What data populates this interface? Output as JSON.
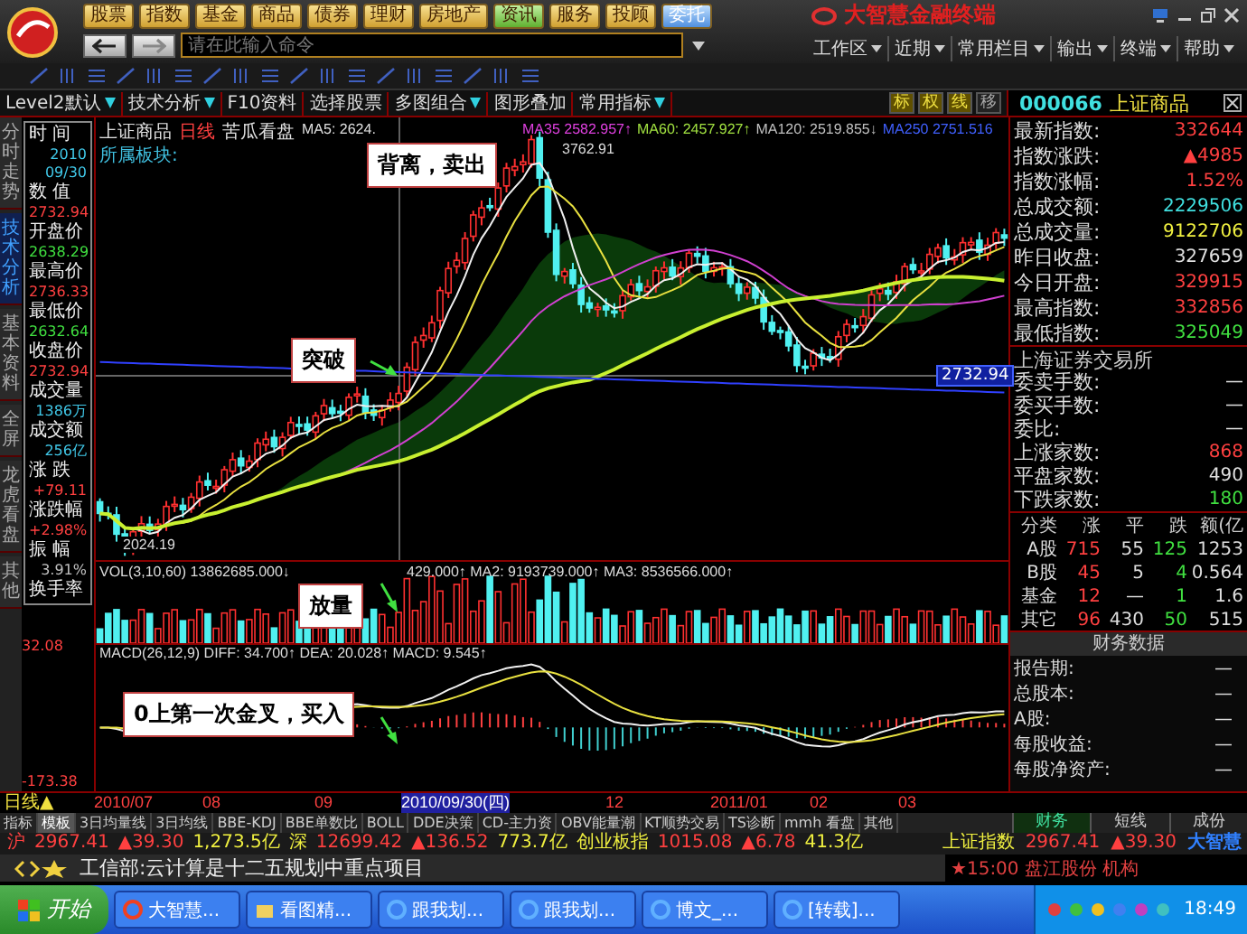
{
  "app": {
    "title": "大智慧金融终端",
    "logo_text": "大智慧"
  },
  "nav_buttons": [
    {
      "label": "股票",
      "kind": "normal"
    },
    {
      "label": "指数",
      "kind": "normal"
    },
    {
      "label": "基金",
      "kind": "normal"
    },
    {
      "label": "商品",
      "kind": "normal"
    },
    {
      "label": "债券",
      "kind": "normal"
    },
    {
      "label": "理财",
      "kind": "normal"
    },
    {
      "label": "房地产",
      "kind": "normal"
    },
    {
      "label": "资讯",
      "kind": "news"
    },
    {
      "label": "服务",
      "kind": "normal"
    },
    {
      "label": "投顾",
      "kind": "normal"
    },
    {
      "label": "委托",
      "kind": "trade"
    }
  ],
  "command_input": {
    "placeholder": "请在此输入命令"
  },
  "menu": [
    "工作区",
    "近期",
    "常用栏目",
    "输出",
    "终端",
    "帮助"
  ],
  "toolbar": [
    {
      "label": "Level2默认",
      "dropdown": true
    },
    {
      "label": "技术分析",
      "dropdown": true
    },
    {
      "label": "F10资料",
      "dropdown": false
    },
    {
      "label": "选择股票",
      "dropdown": false
    },
    {
      "label": "多图组合",
      "dropdown": true
    },
    {
      "label": "图形叠加",
      "dropdown": false
    },
    {
      "label": "常用指标",
      "dropdown": true
    }
  ],
  "toolbar_right": [
    {
      "label": "标",
      "on": true
    },
    {
      "label": "权",
      "on": true
    },
    {
      "label": "线",
      "on": true
    },
    {
      "label": "移",
      "on": false
    }
  ],
  "stock": {
    "code": "000066",
    "name": "上证商品"
  },
  "side_tabs": [
    {
      "label": "分时走势",
      "selected": false
    },
    {
      "label": "技术分析",
      "selected": true
    },
    {
      "label": "基本资料",
      "selected": false
    },
    {
      "label": "全屏",
      "selected": false
    },
    {
      "label": "龙虎看盘",
      "selected": false
    },
    {
      "label": "其他",
      "selected": false
    }
  ],
  "info_panel": [
    {
      "label": "时 间",
      "values": [
        "2010",
        "09/30"
      ],
      "color": "#40c8e8"
    },
    {
      "label": "数 值",
      "values": [
        "2732.94"
      ],
      "color": "#ff4040"
    },
    {
      "label": "开盘价",
      "values": [
        "2638.29"
      ],
      "color": "#40e040"
    },
    {
      "label": "最高价",
      "values": [
        "2736.33"
      ],
      "color": "#ff4040"
    },
    {
      "label": "最低价",
      "values": [
        "2632.64"
      ],
      "color": "#40e040"
    },
    {
      "label": "收盘价",
      "values": [
        "2732.94"
      ],
      "color": "#ff4040"
    },
    {
      "label": "成交量",
      "values": [
        "1386万"
      ],
      "color": "#40c8e8"
    },
    {
      "label": "成交额",
      "values": [
        "256亿"
      ],
      "color": "#40c8e8"
    },
    {
      "label": "涨 跌",
      "values": [
        "+79.11"
      ],
      "color": "#ff4040"
    },
    {
      "label": "涨跌幅",
      "values": [
        "+2.98%"
      ],
      "color": "#ff4040"
    },
    {
      "label": "振 幅",
      "values": [
        "3.91%"
      ],
      "color": "#c0c0c0"
    },
    {
      "label": "换手率"
    }
  ],
  "macd_axis": [
    "32.08",
    "-173.38"
  ],
  "chart": {
    "legend": [
      {
        "text": "上证商品",
        "color": "#e0e0e0"
      },
      {
        "text": "日线",
        "color": "#ff4040"
      },
      {
        "text": "苦瓜看盘",
        "color": "#e0e0e0"
      },
      {
        "text": "MA5: 2624.",
        "color": "#e0e0e0"
      }
    ],
    "legend_right": [
      {
        "text": "MA35 2582.957↑",
        "color": "#e040e0"
      },
      {
        "text": "MA60: 2457.927↑",
        "color": "#a0e040"
      },
      {
        "text": "MA120: 2519.855↓",
        "color": "#c0c0c0"
      },
      {
        "text": "MA250 2751.516",
        "color": "#4060ff"
      }
    ],
    "sector_label": "所属板块:",
    "high_label": "3762.91",
    "low_label": "2024.19",
    "price_tag": "2732.94",
    "volume_legend": "VOL(3,10,60) 13862685.000↓",
    "volume_legend_right": "429.000↑ MA2: 9193739.000↑ MA3: 8536566.000↑",
    "macd_legend": "MACD(26,12,9) DIFF: 34.700↑ DEA: 20.028↑ MACD: 9.545↑"
  },
  "annotations": [
    {
      "text": "背离，卖出",
      "kind": "top"
    },
    {
      "text": "突破",
      "kind": "price"
    },
    {
      "text": "放量",
      "kind": "volume"
    },
    {
      "text": "0上第一次金叉，买入",
      "kind": "macd"
    }
  ],
  "period": "日线▲",
  "dates": [
    {
      "label": "2010/07",
      "highlighted": false
    },
    {
      "label": "08",
      "highlighted": false
    },
    {
      "label": "09",
      "highlighted": false
    },
    {
      "label": "2010/09/30(四)",
      "highlighted": true
    },
    {
      "label": "12",
      "highlighted": false
    },
    {
      "label": "2011/01",
      "highlighted": false
    },
    {
      "label": "02",
      "highlighted": false
    },
    {
      "label": "03",
      "highlighted": false
    }
  ],
  "indicator_tabs": [
    {
      "label": "指标",
      "selected": false
    },
    {
      "label": "模板",
      "selected": true
    },
    {
      "label": "3日均量线",
      "selected": false
    },
    {
      "label": "3日均线",
      "selected": false
    },
    {
      "label": "BBE-KDJ",
      "selected": false
    },
    {
      "label": "BBE单数比",
      "selected": false
    },
    {
      "label": "BOLL",
      "selected": false
    },
    {
      "label": "DDE决策",
      "selected": false
    },
    {
      "label": "CD-主力资",
      "selected": false
    },
    {
      "label": "OBV能量潮",
      "selected": false
    },
    {
      "label": "KT顺势交易",
      "selected": false
    },
    {
      "label": "TS诊断",
      "selected": false
    },
    {
      "label": "mmh 看盘",
      "selected": false
    },
    {
      "label": "其他",
      "selected": false
    }
  ],
  "quote": [
    {
      "label": "最新指数:",
      "value": "332644",
      "color": "#ff4040"
    },
    {
      "label": "指数涨跌:",
      "value": "▲4985",
      "color": "#ff4040"
    },
    {
      "label": "指数涨幅:",
      "value": "1.52%",
      "color": "#ff4040"
    },
    {
      "label": "总成交额:",
      "value": "2229506",
      "color": "#40e0e0"
    },
    {
      "label": "总成交量:",
      "value": "9122706",
      "color": "#f0f040"
    },
    {
      "label": "昨日收盘:",
      "value": "327659",
      "color": "#e0e0e0"
    },
    {
      "label": "今日开盘:",
      "value": "329915",
      "color": "#ff4040"
    },
    {
      "label": "最高指数:",
      "value": "332856",
      "color": "#ff4040"
    },
    {
      "label": "最低指数:",
      "value": "325049",
      "color": "#40e040"
    }
  ],
  "exchange": {
    "title": "上海证券交易所",
    "rows": [
      {
        "label": "委卖手数:",
        "value": "—",
        "color": "#e0e0e0"
      },
      {
        "label": "委买手数:",
        "value": "—",
        "color": "#e0e0e0"
      },
      {
        "label": "委比:",
        "value": "—",
        "color": "#e0e0e0"
      },
      {
        "label": "上涨家数:",
        "value": "868",
        "color": "#ff4040"
      },
      {
        "label": "平盘家数:",
        "value": "490",
        "color": "#e0e0e0"
      },
      {
        "label": "下跌家数:",
        "value": "180",
        "color": "#40e040"
      }
    ]
  },
  "breadth": {
    "columns": [
      "分类",
      "涨",
      "平",
      "跌",
      "额(亿"
    ],
    "rows": [
      [
        "A股",
        "715",
        "55",
        "125",
        "1253"
      ],
      [
        "B股",
        "45",
        "5",
        "4",
        "0.564"
      ],
      [
        "基金",
        "12",
        "—",
        "1",
        "1.6"
      ],
      [
        "其它",
        "96",
        "430",
        "50",
        "515"
      ]
    ]
  },
  "finance": {
    "title": "财务数据",
    "rows": [
      {
        "label": "报告期:",
        "value": "—"
      },
      {
        "label": "总股本:",
        "value": "—"
      },
      {
        "label": "A股:",
        "value": "—"
      },
      {
        "label": "每股收益:",
        "value": "—"
      },
      {
        "label": "每股净资产:",
        "value": "—"
      }
    ],
    "tabs": [
      {
        "label": "财务",
        "selected": true
      },
      {
        "label": "短线",
        "selected": false
      },
      {
        "label": "成份",
        "selected": false
      }
    ]
  },
  "ticker": [
    {
      "text": "沪",
      "color": "#ff4040"
    },
    {
      "text": "2967.41",
      "color": "#ff4040"
    },
    {
      "text": "▲39.30",
      "color": "#ff4040"
    },
    {
      "text": "1,273.5亿",
      "color": "#f0f040"
    },
    {
      "text": "深",
      "color": "#f0f040"
    },
    {
      "text": "12699.42",
      "color": "#ff4040"
    },
    {
      "text": "▲136.52",
      "color": "#ff4040"
    },
    {
      "text": "773.7亿",
      "color": "#f0f040"
    },
    {
      "text": "创业板指",
      "color": "#f0f040"
    },
    {
      "text": "1015.08",
      "color": "#ff4040"
    },
    {
      "text": "▲6.78",
      "color": "#ff4040"
    },
    {
      "text": "41.3亿",
      "color": "#f0f040"
    }
  ],
  "ticker_right": [
    {
      "text": "上证指数",
      "color": "#f0f040"
    },
    {
      "text": "2967.41",
      "color": "#ff4040"
    },
    {
      "text": "▲39.30",
      "color": "#ff4040"
    }
  ],
  "news": {
    "headline": "工信部:云计算是十二五规划中重点项目",
    "side": "★15:00 盘江股份 机构"
  },
  "taskbar": {
    "start": "开始",
    "tasks": [
      "大智慧...",
      "看图精...",
      "跟我划...",
      "跟我划...",
      "博文_...",
      "[转载]..."
    ],
    "clock": "18:49"
  }
}
